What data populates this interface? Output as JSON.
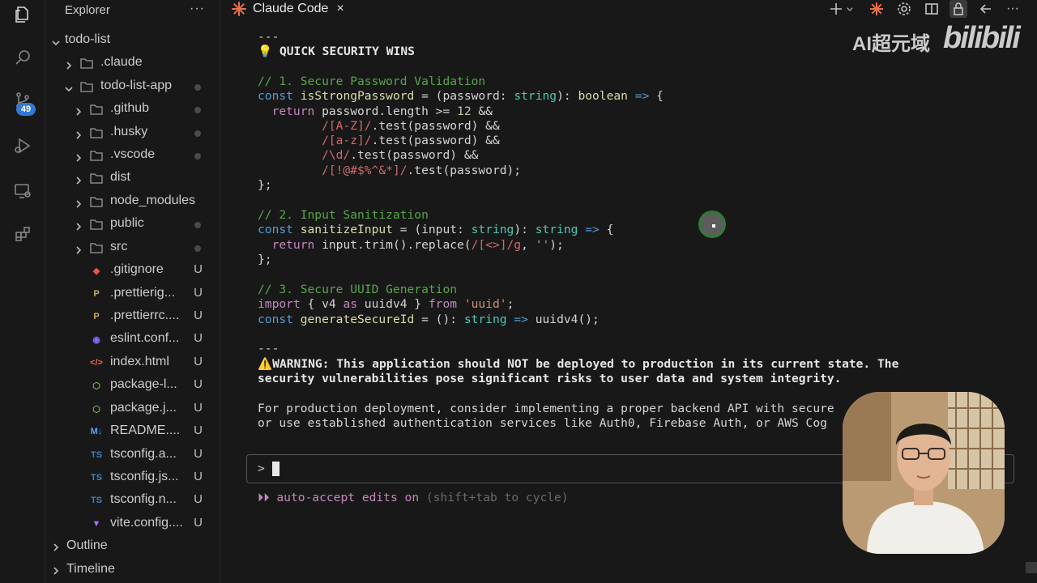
{
  "activity_bar": {
    "items": [
      {
        "name": "explorer-icon"
      },
      {
        "name": "search-icon"
      },
      {
        "name": "source-control-icon"
      },
      {
        "name": "run-debug-icon"
      },
      {
        "name": "remote-explorer-icon"
      },
      {
        "name": "extensions-icon"
      }
    ],
    "source_control_badge": "49"
  },
  "sidebar": {
    "title": "Explorer",
    "more": "···",
    "tree": [
      {
        "label": "todo-list",
        "kind": "root-folder",
        "status": ""
      },
      {
        "label": ".claude",
        "kind": "folder",
        "status": ""
      },
      {
        "label": "todo-list-app",
        "kind": "folder-open",
        "status": "dot"
      },
      {
        "label": ".github",
        "kind": "folder",
        "status": "dot"
      },
      {
        "label": ".husky",
        "kind": "folder",
        "status": "dot"
      },
      {
        "label": ".vscode",
        "kind": "folder",
        "status": "dot"
      },
      {
        "label": "dist",
        "kind": "folder",
        "status": ""
      },
      {
        "label": "node_modules",
        "kind": "folder",
        "status": ""
      },
      {
        "label": "public",
        "kind": "folder",
        "status": "dot"
      },
      {
        "label": "src",
        "kind": "folder",
        "status": "dot"
      },
      {
        "label": ".gitignore",
        "kind": "file",
        "status": "U"
      },
      {
        "label": ".prettierig...",
        "kind": "file",
        "status": "U"
      },
      {
        "label": ".prettierrc....",
        "kind": "file",
        "status": "U"
      },
      {
        "label": "eslint.conf...",
        "kind": "file",
        "status": "U"
      },
      {
        "label": "index.html",
        "kind": "file",
        "status": "U"
      },
      {
        "label": "package-l...",
        "kind": "file",
        "status": "U"
      },
      {
        "label": "package.j...",
        "kind": "file",
        "status": "U"
      },
      {
        "label": "README....",
        "kind": "file",
        "status": "U"
      },
      {
        "label": "tsconfig.a...",
        "kind": "file",
        "status": "U"
      },
      {
        "label": "tsconfig.js...",
        "kind": "file",
        "status": "U"
      },
      {
        "label": "tsconfig.n...",
        "kind": "file",
        "status": "U"
      },
      {
        "label": "vite.config....",
        "kind": "file",
        "status": "U"
      }
    ],
    "outline": "Outline",
    "timeline": "Timeline"
  },
  "tabbar": {
    "active_tab": "Claude Code",
    "close": "×"
  },
  "editor": {
    "separator_top": "---",
    "quick_wins_title": "💡 QUICK SECURITY WINS",
    "comment1": "// 1. Secure Password Validation",
    "comment2": "// 2. Input Sanitization",
    "comment3": "// 3. Secure UUID Generation",
    "separator_mid": "---",
    "warning_line1": "⚠️WARNING: This application should NOT be deployed to production in its current state. The",
    "warning_line2": "security vulnerabilities pose significant risks to user data and system integrity.",
    "prod_line1": "For production deployment, consider implementing a proper backend API with secure",
    "prod_line2": "or use established authentication services like Auth0, Firebase Auth, or AWS Cog",
    "prompt_symbol": ">",
    "auto_accept_prefix": "⏵⏵ auto-accept edits on",
    "auto_accept_hint": "(shift+tab to cycle)"
  },
  "watermark": {
    "text": "AI超元域",
    "logo": "bilibili"
  },
  "colors": {
    "background": "#181818",
    "comment": "#57a64a",
    "keyword": "#569cd6",
    "type": "#4ec9b0",
    "regex": "#d16969",
    "accent_badge": "#2f7ad6",
    "tab_icon": "#e8704a"
  }
}
